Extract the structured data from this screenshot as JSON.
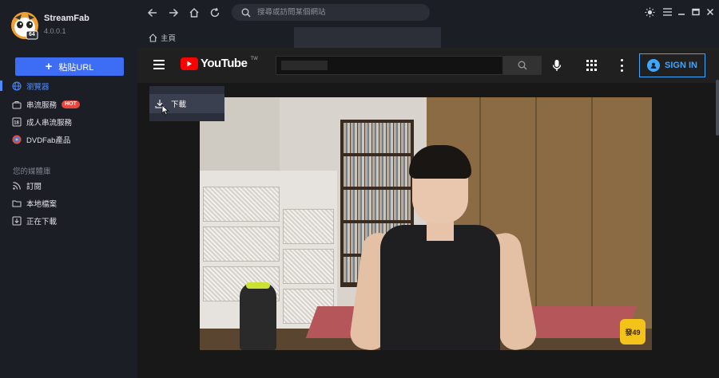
{
  "app": {
    "name": "StreamFab",
    "version": "4.0.0.1",
    "logo_badge": "64"
  },
  "sidebar": {
    "paste_button": "粘貼URL",
    "items": [
      {
        "label": "瀏覽器",
        "icon": "globe-icon",
        "active": true
      },
      {
        "label": "串流服務",
        "icon": "briefcase-icon",
        "badge": "HOT"
      },
      {
        "label": "成人串流服務",
        "icon": "adult-18-icon"
      },
      {
        "label": "DVDFab產品",
        "icon": "dvdfab-logo-icon"
      }
    ],
    "library_label": "您的媒體庫",
    "library_items": [
      {
        "label": "訂閱",
        "icon": "rss-icon"
      },
      {
        "label": "本地檔案",
        "icon": "folder-icon"
      },
      {
        "label": "正在下載",
        "icon": "download-box-icon"
      }
    ]
  },
  "toolbar": {
    "address_placeholder": "搜尋或訪問某個網站"
  },
  "tab": {
    "home_label": "主頁"
  },
  "youtube": {
    "logo_text": "YouTube",
    "logo_tm": "TW",
    "signin_label": "SIGN IN"
  },
  "download_popup": {
    "label": "下載"
  },
  "video": {
    "badge_text": "發49"
  },
  "colors": {
    "accent": "#3d6df5",
    "hot": "#e8453c",
    "yt_red": "#ff0000",
    "yt_blue": "#3ea6ff"
  }
}
